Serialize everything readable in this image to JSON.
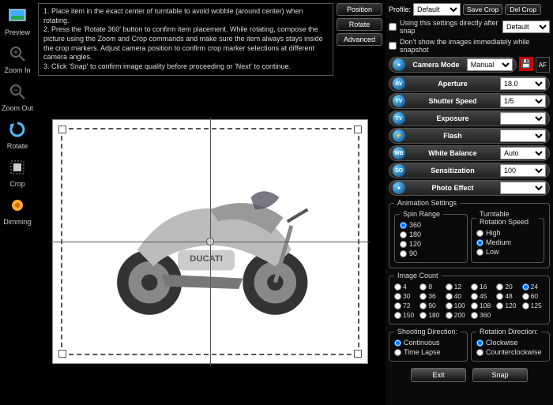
{
  "sidebar": [
    {
      "name": "preview",
      "label": "Preview"
    },
    {
      "name": "zoom-in",
      "label": "Zoom In"
    },
    {
      "name": "zoom-out",
      "label": "Zoom Out"
    },
    {
      "name": "rotate",
      "label": "Rotate"
    },
    {
      "name": "crop",
      "label": "Crop"
    },
    {
      "name": "dimming",
      "label": "Dimming"
    }
  ],
  "instructions": {
    "line1": "1. Place item in the exact center of turntable to avoid wobble (around center) when rotating.",
    "line2": "2. Press the 'Rotate 360' button to confirm item placement. While rotating, compose the picture using the Zoom and Crop commands and make sure the item always stays inside the crop markers. Adjust camera position to confirm crop marker selections at different camera angles.",
    "line3": "3. Click 'Snap' to confirm image quality before proceeding or 'Next' to continue."
  },
  "top_buttons": {
    "position": "Position",
    "rotate": "Rotate",
    "advanced": "Advanced"
  },
  "profile": {
    "label": "Profile:",
    "value": "Default",
    "save": "Save Crop",
    "del": "Del Crop"
  },
  "chk1": {
    "label": "Using this settings directly after snap",
    "value": "Default"
  },
  "chk2": {
    "label": "Don't show the images immediately while snapshot"
  },
  "settings": [
    {
      "badge": "●",
      "label": "Camera Mode",
      "value": "Manual"
    },
    {
      "badge": "AV",
      "label": "Aperture",
      "value": "18.0"
    },
    {
      "badge": "TV",
      "label": "Shutter Speed",
      "value": "1/5"
    },
    {
      "badge": "TV",
      "label": "Exposure",
      "value": ""
    },
    {
      "badge": "⚡",
      "label": "Flash",
      "value": ""
    },
    {
      "badge": "WB",
      "label": "White Balance",
      "value": "Auto"
    },
    {
      "badge": "SO",
      "label": "Sensitization",
      "value": "100"
    },
    {
      "badge": "●",
      "label": "Photo Effect",
      "value": ""
    }
  ],
  "af_label": "AF",
  "anim": {
    "legend": "Animation Settings"
  },
  "spin": {
    "legend": "Spin Range",
    "options": [
      "360",
      "180",
      "120",
      "90"
    ],
    "selected": "360"
  },
  "speed": {
    "legend": "Turntable Rotation Speed",
    "options": [
      "High",
      "Medium",
      "Low"
    ],
    "selected": "Medium"
  },
  "imgcount": {
    "legend": "Image Count",
    "options": [
      "4",
      "8",
      "12",
      "16",
      "20",
      "24",
      "30",
      "36",
      "40",
      "45",
      "48",
      "60",
      "72",
      "90",
      "100",
      "108",
      "120",
      "125",
      "150",
      "180",
      "200",
      "360"
    ],
    "selected": "24"
  },
  "shoot": {
    "legend": "Shooting Direction:",
    "options": [
      "Continuous",
      "Time Lapse"
    ],
    "selected": "Continuous"
  },
  "rot": {
    "legend": "Rotation Direction:",
    "options": [
      "Clockwise",
      "Counterclockwise"
    ],
    "selected": "Clockwise"
  },
  "bottom": {
    "exit": "Exit",
    "snap": "Snap"
  }
}
